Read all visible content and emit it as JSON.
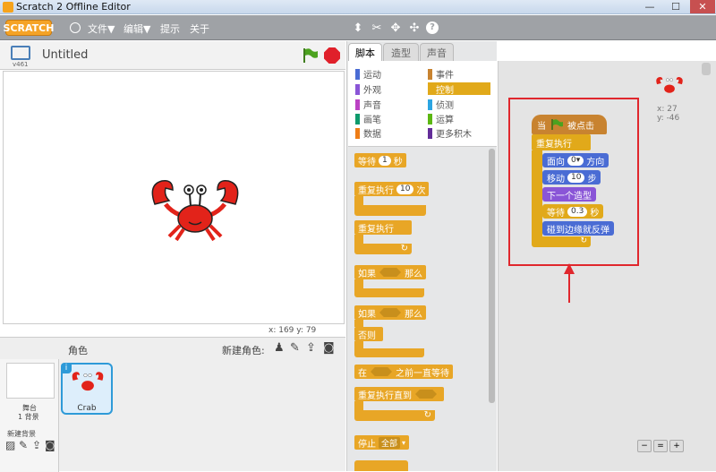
{
  "window": {
    "title": "Scratch 2 Offline Editor"
  },
  "menubar": {
    "logo": "SCRATCH",
    "items": [
      "文件▼",
      "编辑▼",
      "提示",
      "关于"
    ]
  },
  "stage": {
    "title": "Untitled",
    "version": "v461",
    "coords": "x: 169  y: 79"
  },
  "sprites": {
    "header": "角色",
    "new_sprite_label": "新建角色:",
    "backdrop_label": "舞台",
    "backdrop_count": "1 背景",
    "new_backdrop_label": "新建背景",
    "sprite_name": "Crab"
  },
  "tabs": [
    "脚本",
    "造型",
    "声音"
  ],
  "categories": [
    {
      "label": "运动",
      "color": "#4a6cd4"
    },
    {
      "label": "事件",
      "color": "#c88330"
    },
    {
      "label": "外观",
      "color": "#8a55d7"
    },
    {
      "label": "控制",
      "color": "#e1a91a"
    },
    {
      "label": "声音",
      "color": "#bb42c3"
    },
    {
      "label": "侦测",
      "color": "#2ca5e2"
    },
    {
      "label": "画笔",
      "color": "#0e9a6c"
    },
    {
      "label": "运算",
      "color": "#5cb712"
    },
    {
      "label": "数据",
      "color": "#ee7d16"
    },
    {
      "label": "更多积木",
      "color": "#632d99"
    }
  ],
  "palette": {
    "wait_a": "等待",
    "wait_v": "1",
    "wait_b": "秒",
    "repeat_a": "重复执行",
    "repeat_v": "10",
    "repeat_b": "次",
    "forever": "重复执行",
    "if_a": "如果",
    "if_b": "那么",
    "if2_a": "如果",
    "if2_b": "那么",
    "else": "否则",
    "waituntil_a": "在",
    "waituntil_b": "之前一直等待",
    "repeatuntil": "重复执行直到",
    "stop_a": "停止",
    "stop_v": "全部"
  },
  "script": {
    "hat_a": "当",
    "hat_b": "被点击",
    "forever": "重复执行",
    "point_a": "面向",
    "point_v": "0▾",
    "point_b": "方向",
    "move_a": "移动",
    "move_v": "10",
    "move_b": "步",
    "next_costume": "下一个造型",
    "wait_a": "等待",
    "wait_v": "0.3",
    "wait_b": "秒",
    "bounce": "碰到边缘就反弹"
  },
  "sprite_info": {
    "x": "x: 27",
    "y": "y: -46"
  },
  "colors": {
    "control": "#e1a91a",
    "motion": "#4a6cd4",
    "looks": "#8a55d7",
    "events": "#c88330",
    "highlight": "#e0272d"
  }
}
